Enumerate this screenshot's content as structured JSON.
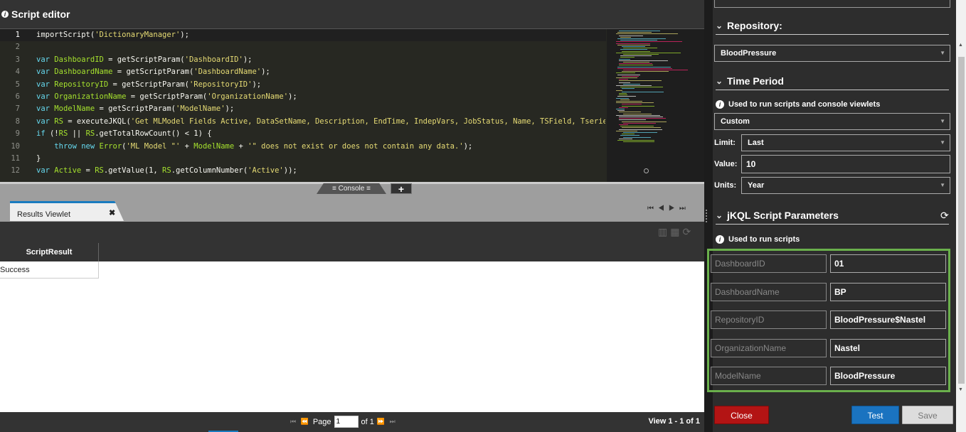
{
  "title": "Script editor",
  "editor": {
    "lines": [
      {
        "n": "1",
        "html": "importScript(<span class='s'>'DictionaryManager'</span>);"
      },
      {
        "n": "2",
        "html": ""
      },
      {
        "n": "3",
        "html": "<span class='k'>var</span> <span class='v'>DashboardID</span> = getScriptParam(<span class='s'>'DashboardID'</span>);"
      },
      {
        "n": "4",
        "html": "<span class='k'>var</span> <span class='v'>DashboardName</span> = getScriptParam(<span class='s'>'DashboardName'</span>);"
      },
      {
        "n": "5",
        "html": "<span class='k'>var</span> <span class='v'>RepositoryID</span> = getScriptParam(<span class='s'>'RepositoryID'</span>);"
      },
      {
        "n": "6",
        "html": "<span class='k'>var</span> <span class='v'>OrganizationName</span> = getScriptParam(<span class='s'>'OrganizationName'</span>);"
      },
      {
        "n": "7",
        "html": "<span class='k'>var</span> <span class='v'>ModelName</span> = getScriptParam(<span class='s'>'ModelName'</span>);"
      },
      {
        "n": "8",
        "html": "<span class='k'>var</span> <span class='v'>RS</span> = executeJKQL(<span class='s'>'Get MLModel Fields Active, DataSetName, Description, EndTime, IndepVars, JobStatus, Name, TSField, Tseries, Tse</span>"
      },
      {
        "n": "9",
        "html": "<span class='k'>if</span> (!<span class='v'>RS</span> || <span class='v'>RS</span>.getTotalRowCount() &lt; 1) {"
      },
      {
        "n": "10",
        "html": "    <span class='k'>throw</span> <span class='k'>new</span> <span class='v'>Error</span>(<span class='s'>'ML Model \"'</span> + <span class='v'>ModelName</span> + <span class='s'>'\" does not exist or does not contain any data.'</span>);"
      },
      {
        "n": "11",
        "html": "}"
      },
      {
        "n": "12",
        "html": "<span class='k'>var</span> <span class='v'>Active</span> = <span class='v'>RS</span>.getValue(1, <span class='v'>RS</span>.getColumnNumber(<span class='s'>'Active'</span>));"
      }
    ]
  },
  "console_tab": "Console",
  "viewlet": {
    "tab_label": "Results Viewlet",
    "column": "ScriptResult",
    "rows": [
      "Success"
    ]
  },
  "footer": {
    "page_label": "Page",
    "page_value": "1",
    "of_label": "of 1",
    "view_info": "View 1 - 1 of 1"
  },
  "panel": {
    "repository": {
      "header": "Repository:",
      "value": "BloodPressure"
    },
    "time_period": {
      "header": "Time Period",
      "note": "Used to run scripts and console viewlets",
      "mode": "Custom",
      "limit_label": "Limit:",
      "limit_value": "Last",
      "value_label": "Value:",
      "value_value": "10",
      "units_label": "Units:",
      "units_value": "Year"
    },
    "params": {
      "header": "jKQL Script Parameters",
      "note": "Used to run scripts",
      "items": [
        {
          "name": "DashboardID",
          "value": "01"
        },
        {
          "name": "DashboardName",
          "value": "BP"
        },
        {
          "name": "RepositoryID",
          "value": "BloodPressure$Nastel"
        },
        {
          "name": "OrganizationName",
          "value": "Nastel"
        },
        {
          "name": "ModelName",
          "value": "BloodPressure"
        }
      ]
    },
    "buttons": {
      "close": "Close",
      "test": "Test",
      "save": "Save"
    }
  }
}
